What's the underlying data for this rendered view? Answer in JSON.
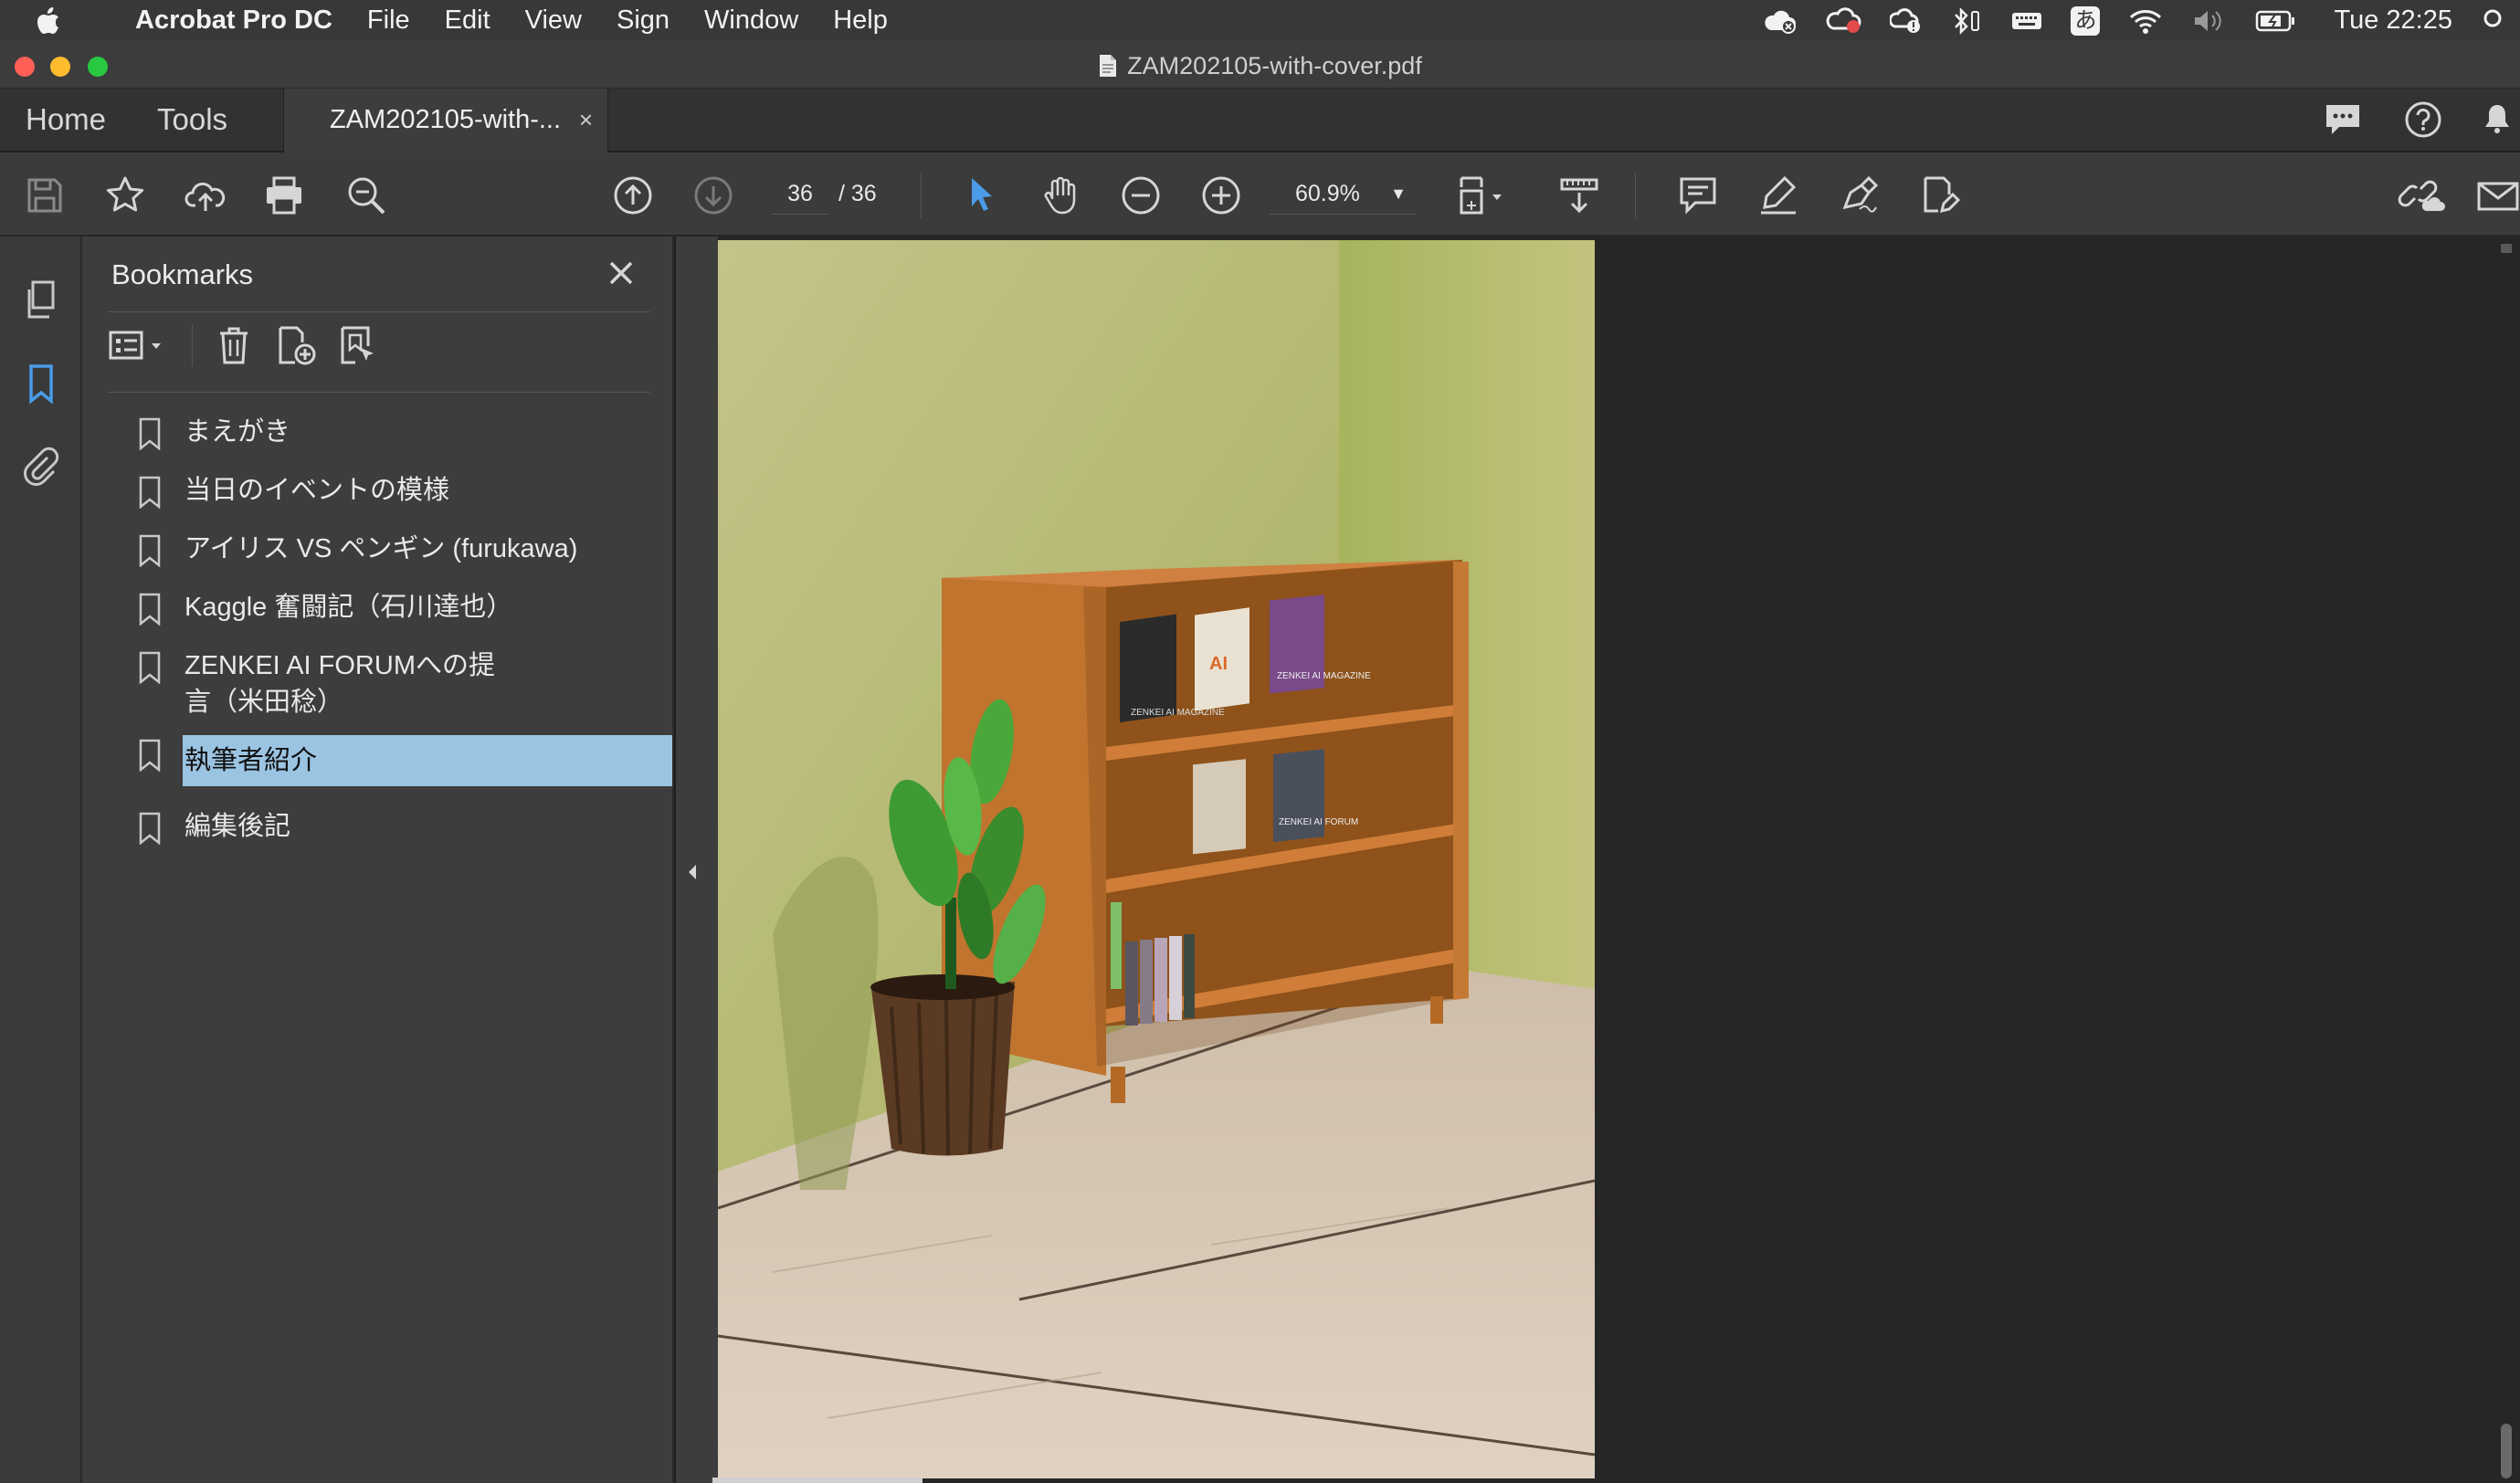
{
  "menubar": {
    "app_name": "Acrobat Pro DC",
    "items": [
      "File",
      "Edit",
      "View",
      "Sign",
      "Window",
      "Help"
    ],
    "ime": "あ",
    "clock": "Tue 22:25"
  },
  "window": {
    "title": "ZAM202105-with-cover.pdf"
  },
  "tabs": {
    "home": "Home",
    "tools": "Tools",
    "doc": "ZAM202105-with-...",
    "doc_close": "×"
  },
  "toolbar": {
    "page_current": "36",
    "page_total": "/  36",
    "zoom": "60.9%"
  },
  "bookmarks": {
    "title": "Bookmarks",
    "items": [
      {
        "label": "まえがき",
        "selected": false
      },
      {
        "label": "当日のイベントの模様",
        "selected": false
      },
      {
        "label": "アイリス VS ペンギン (furukawa)",
        "selected": false
      },
      {
        "label": "Kaggle 奮闘記（石川達也）",
        "selected": false
      },
      {
        "label": "ZENKEI AI FORUMへの提言（米田稔）",
        "selected": false
      },
      {
        "label": "執筆者紹介",
        "selected": true
      },
      {
        "label": "編集後記",
        "selected": false
      }
    ]
  },
  "page_image": {
    "book_covers": [
      "ZENKEI AI MAGAZINE",
      "AI",
      "ZENKEI AI MAGAZINE",
      "ZENKEI AI FORUM"
    ]
  },
  "colors": {
    "accent": "#4a9be8",
    "selection": "#9bc4e2",
    "wall": "#b8c07a",
    "shelf": "#b86a24",
    "floor": "#d8c6b0"
  }
}
